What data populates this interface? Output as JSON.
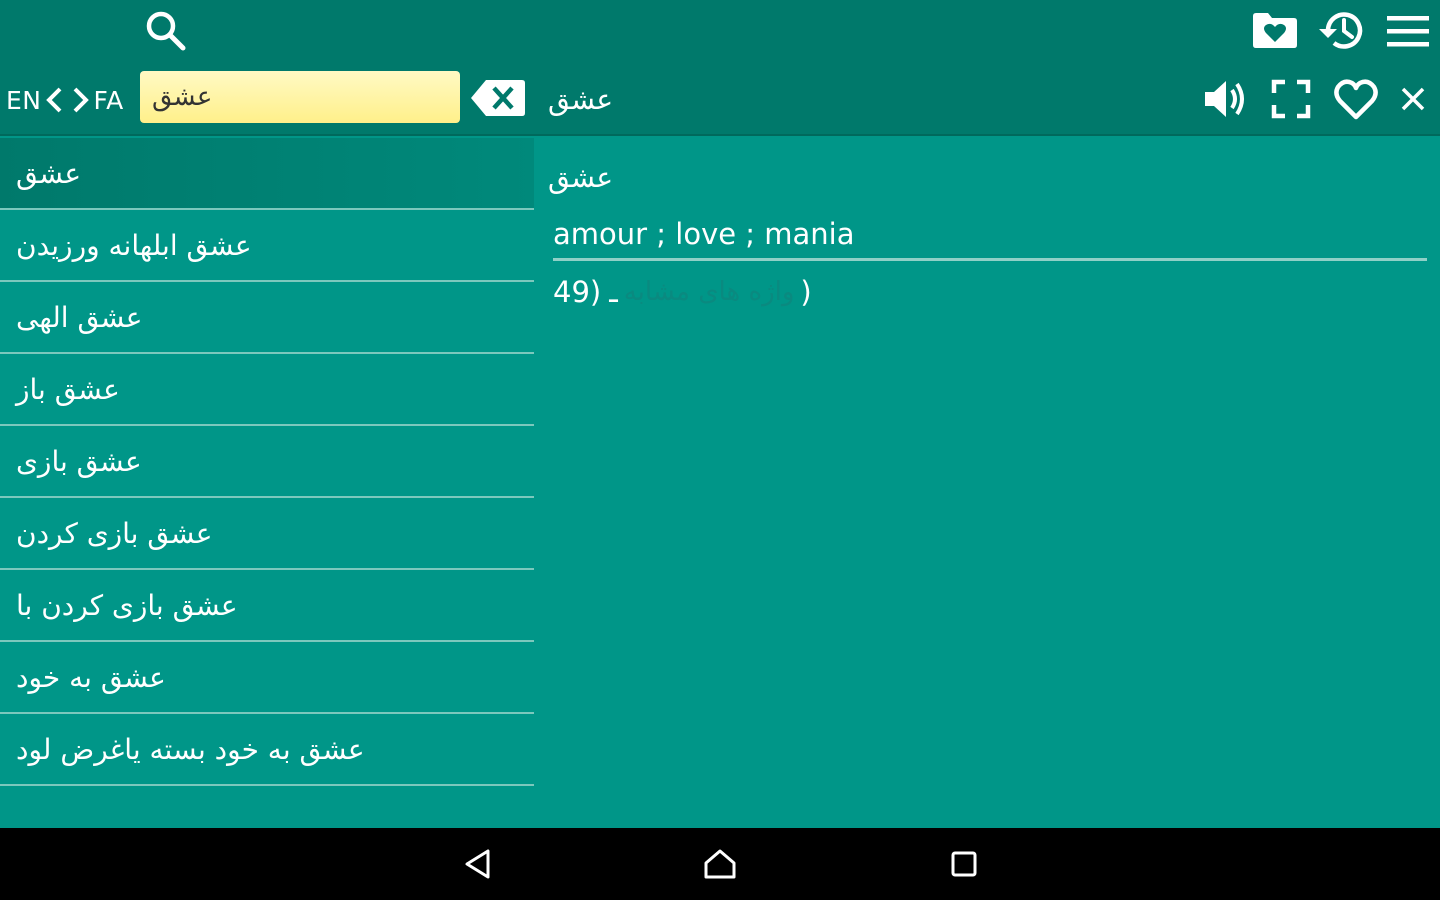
{
  "toolbar": {
    "search_icon": "search-icon",
    "favorites_folder_icon": "favorites-folder-icon",
    "history_icon": "history-icon",
    "menu_icon": "menu-icon"
  },
  "search": {
    "lang_from": "EN",
    "lang_to": "FA",
    "value": "عشق"
  },
  "header": {
    "word": "عشق"
  },
  "word_list": [
    "عشق",
    "عشق ابلهانه ورزیدن",
    "عشق الهی",
    "عشق باز",
    "عشق بازی",
    "عشق بازی کردن",
    "عشق بازی کردن با",
    "عشق به خود",
    "عشق به خود بسته یاغرض لود"
  ],
  "detail": {
    "word": "عشق",
    "translation": "amour ; love ; mania",
    "note_number": "49)",
    "note_dash": "ـ",
    "note_link": "واژه های مشابه",
    "note_close": ")"
  },
  "colors": {
    "primary": "#009688",
    "primary_dark": "#00796b",
    "search_bg": "#fff59d"
  }
}
